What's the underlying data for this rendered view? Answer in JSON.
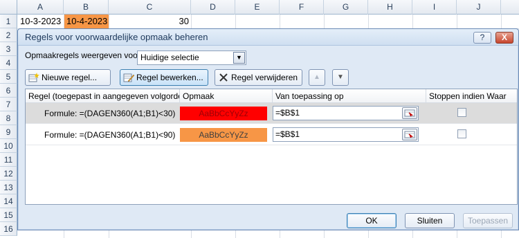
{
  "spreadsheet": {
    "columns": [
      "A",
      "B",
      "C",
      "D",
      "E",
      "F",
      "G",
      "H",
      "I",
      "J"
    ],
    "rows": [
      "1",
      "2",
      "3",
      "4",
      "5",
      "6",
      "7",
      "8",
      "9",
      "10",
      "11",
      "12",
      "13",
      "14",
      "15",
      "16"
    ],
    "cells": {
      "a1": "10-3-2023",
      "b1": "10-4-2023",
      "c1": "30"
    },
    "b1_fill": "#f79646"
  },
  "dialog": {
    "title": "Regels voor voorwaardelijke opmaak beheren",
    "help_label": "?",
    "close_label": "X",
    "show_rules_label": "Opmaakregels weergeven voor:",
    "show_rules_value": "Huidige selectie",
    "toolbar": {
      "new_rule": "Nieuwe regel...",
      "edit_rule": "Regel bewerken...",
      "delete_rule": "Regel verwijderen",
      "move_up": "▲",
      "move_down": "▼"
    },
    "columns": {
      "rule": "Regel (toegepast in aangegeven volgorde)",
      "format": "Opmaak",
      "applies_to": "Van toepassing op",
      "stop_if_true": "Stoppen indien Waar"
    },
    "rules": [
      {
        "formula": "Formule: =(DAGEN360(A1;B1)<30)",
        "preview": "AaBbCcYyZz",
        "preview_bg": "#ff0000",
        "applies_to": "=$B$1",
        "stop": false,
        "selected": true
      },
      {
        "formula": "Formule: =(DAGEN360(A1;B1)<90)",
        "preview": "AaBbCcYyZz",
        "preview_bg": "#f79646",
        "applies_to": "=$B$1",
        "stop": false,
        "selected": false
      }
    ],
    "footer": {
      "ok": "OK",
      "close": "Sluiten",
      "apply": "Toepassen"
    }
  }
}
